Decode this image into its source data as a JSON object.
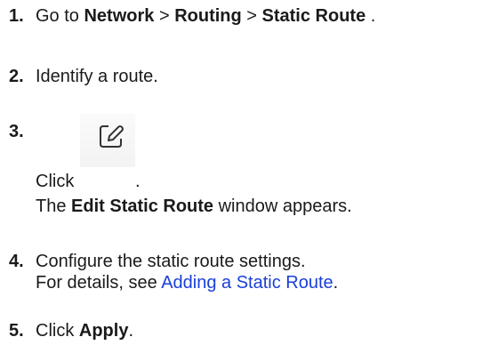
{
  "steps": [
    {
      "number": "1.",
      "text_parts": [
        "Go to ",
        "Network",
        " > ",
        "Routing",
        " > ",
        "Static Route",
        " ."
      ]
    },
    {
      "number": "2.",
      "text": "Identify a route."
    },
    {
      "number": "3.",
      "click_label": "Click",
      "click_end": ".",
      "result_prefix": "The ",
      "result_bold": "Edit Static Route",
      "result_suffix": " window appears.",
      "icon": "edit-icon"
    },
    {
      "number": "4.",
      "text": "Configure the static route settings.",
      "details_prefix": "For details, see ",
      "details_link": "Adding a Static Route",
      "details_suffix": "."
    },
    {
      "number": "5.",
      "text_prefix": "Click ",
      "text_bold": "Apply",
      "text_suffix": "."
    }
  ],
  "colors": {
    "text": "#1a1a1a",
    "link": "#1a3fd8"
  }
}
